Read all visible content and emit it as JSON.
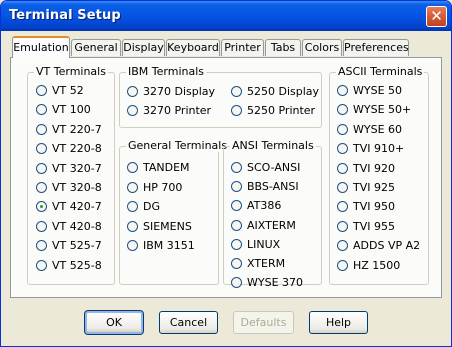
{
  "window": {
    "title": "Terminal Setup"
  },
  "tabs": [
    {
      "label": "Emulation"
    },
    {
      "label": "General"
    },
    {
      "label": "Display"
    },
    {
      "label": "Keyboard"
    },
    {
      "label": "Printer"
    },
    {
      "label": "Tabs"
    },
    {
      "label": "Colors"
    },
    {
      "label": "Preferences"
    }
  ],
  "active_tab": "Emulation",
  "groups": {
    "vt": {
      "title": "VT Terminals",
      "items": [
        "VT 52",
        "VT 100",
        "VT 220-7",
        "VT 220-8",
        "VT 320-7",
        "VT 320-8",
        "VT 420-7",
        "VT 420-8",
        "VT 525-7",
        "VT 525-8"
      ]
    },
    "ibm": {
      "title": "IBM Terminals",
      "items": [
        "3270 Display",
        "5250 Display",
        "3270 Printer",
        "5250 Printer"
      ]
    },
    "general": {
      "title": "General Terminals",
      "items": [
        "TANDEM",
        "HP 700",
        "DG",
        "SIEMENS",
        "IBM 3151"
      ]
    },
    "ansi": {
      "title": "ANSI Terminals",
      "items": [
        "SCO-ANSI",
        "BBS-ANSI",
        "AT386",
        "AIXTERM",
        "LINUX",
        "XTERM",
        "WYSE 370"
      ]
    },
    "ascii": {
      "title": "ASCII Terminals",
      "items": [
        "WYSE 50",
        "WYSE 50+",
        "WYSE 60",
        "TVI 910+",
        "TVI 920",
        "TVI 925",
        "TVI 950",
        "TVI 955",
        "ADDS VP A2",
        "HZ 1500"
      ]
    }
  },
  "selected_terminal": "VT 420-7",
  "buttons": {
    "ok": "OK",
    "cancel": "Cancel",
    "defaults": "Defaults",
    "help": "Help"
  }
}
